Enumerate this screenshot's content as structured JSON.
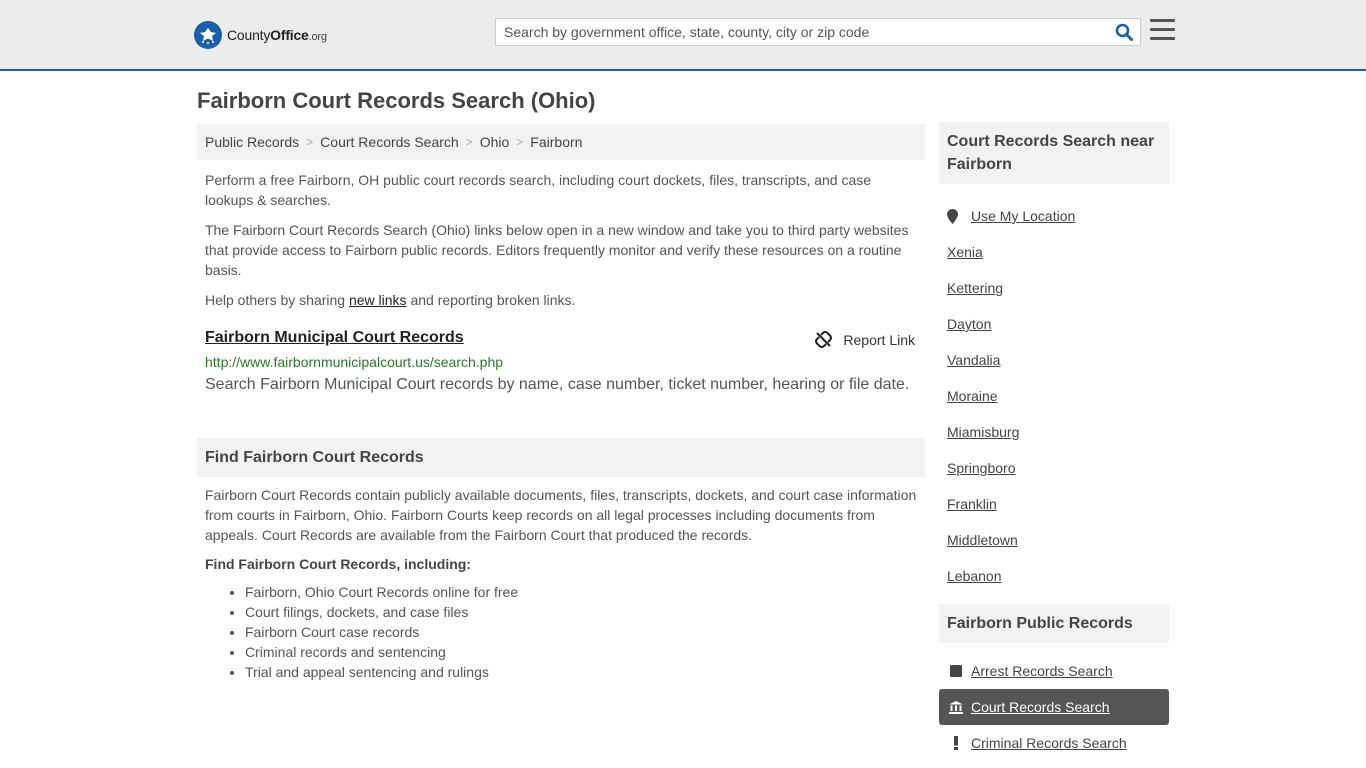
{
  "header": {
    "logo_county": "County",
    "logo_office": "Office",
    "logo_org": ".org",
    "search_placeholder": "Search by government office, state, county, city or zip code"
  },
  "page": {
    "title": "Fairborn Court Records Search (Ohio)"
  },
  "breadcrumb": [
    "Public Records",
    "Court Records Search",
    "Ohio",
    "Fairborn"
  ],
  "intro": {
    "p1": "Perform a free Fairborn, OH public court records search, including court dockets, files, transcripts, and case lookups & searches.",
    "p2": "The Fairborn Court Records Search (Ohio) links below open in a new window and take you to third party websites that provide access to Fairborn public records. Editors frequently monitor and verify these resources on a routine basis.",
    "p3_before": "Help others by sharing ",
    "p3_link": "new links",
    "p3_after": " and reporting broken links."
  },
  "record": {
    "title": "Fairborn Municipal Court Records",
    "report_label": "Report Link",
    "url": "http://www.fairbornmunicipalcourt.us/search.php",
    "description": "Search Fairborn Municipal Court records by name, case number, ticket number, hearing or file date."
  },
  "find": {
    "heading": "Find Fairborn Court Records",
    "paragraph": "Fairborn Court Records contain publicly available documents, files, transcripts, dockets, and court case information from courts in Fairborn, Ohio. Fairborn Courts keep records on all legal processes including documents from appeals. Court Records are available from the Fairborn Court that produced the records.",
    "subheading": "Find Fairborn Court Records, including:",
    "bullets": [
      "Fairborn, Ohio Court Records online for free",
      "Court filings, dockets, and case files",
      "Fairborn Court case records",
      "Criminal records and sentencing",
      "Trial and appeal sentencing and rulings"
    ]
  },
  "sidebar": {
    "nearby_heading": "Court Records Search near Fairborn",
    "use_location": "Use My Location",
    "nearby": [
      "Xenia",
      "Kettering",
      "Dayton",
      "Vandalia",
      "Moraine",
      "Miamisburg",
      "Springboro",
      "Franklin",
      "Middletown",
      "Lebanon"
    ],
    "public_heading": "Fairborn Public Records",
    "public_records": [
      "Arrest Records Search",
      "Court Records Search",
      "Criminal Records Search"
    ]
  },
  "colors": {
    "brand_blue": "#1b5fa6",
    "url_green": "#2a7a2a",
    "active_bg": "#555555"
  }
}
